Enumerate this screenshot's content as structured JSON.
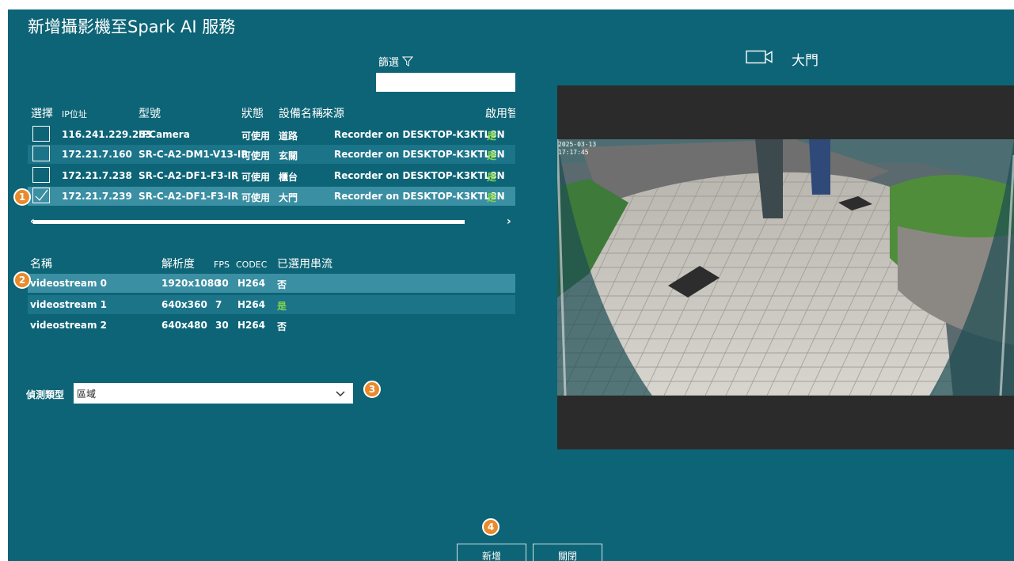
{
  "title": "新增攝影機至Spark AI 服務",
  "filter": {
    "label": "篩選",
    "value": ""
  },
  "camera_table": {
    "headers": {
      "select": "選擇",
      "ip": "IP位址",
      "model": "型號",
      "status": "狀態",
      "device_name": "設備名稱",
      "source": "來源",
      "enabled": "啟用智"
    },
    "rows": [
      {
        "ip": "116.241.229.253",
        "model": "IPCamera",
        "status": "可使用",
        "device_name": "道路",
        "source": "Recorder on DESKTOP-K3KTL8N",
        "enabled": "是",
        "checked": false
      },
      {
        "ip": "172.21.7.160",
        "model": "SR-C-A2-DM1-V13-IR",
        "status": "可使用",
        "device_name": "玄關",
        "source": "Recorder on DESKTOP-K3KTL8N",
        "enabled": "是",
        "checked": false
      },
      {
        "ip": "172.21.7.238",
        "model": "SR-C-A2-DF1-F3-IR",
        "status": "可使用",
        "device_name": "櫃台",
        "source": "Recorder on DESKTOP-K3KTL8N",
        "enabled": "是",
        "checked": false
      },
      {
        "ip": "172.21.7.239",
        "model": "SR-C-A2-DF1-F3-IR",
        "status": "可使用",
        "device_name": "大門",
        "source": "Recorder on DESKTOP-K3KTL8N",
        "enabled": "是",
        "checked": true
      }
    ],
    "scroll_left": "‹",
    "scroll_right": "›"
  },
  "stream_table": {
    "headers": {
      "name": "名稱",
      "resolution": "解析度",
      "fps": "FPS",
      "codec": "CODEC",
      "selected": "已選用串流"
    },
    "rows": [
      {
        "name": "videostream 0",
        "resolution": "1920x1080",
        "fps": "30",
        "codec": "H264",
        "selected": "否"
      },
      {
        "name": "videostream 1",
        "resolution": "640x360",
        "fps": "7",
        "codec": "H264",
        "selected": "是"
      },
      {
        "name": "videostream 2",
        "resolution": "640x480",
        "fps": "30",
        "codec": "H264",
        "selected": "否"
      }
    ]
  },
  "detection": {
    "label": "偵測類型",
    "value": "區域"
  },
  "buttons": {
    "add": "新增",
    "close": "關閉"
  },
  "badges": [
    "1",
    "2",
    "3",
    "4"
  ],
  "preview": {
    "camera_name": "大門",
    "timestamp": "2025-03-13 17:17:45"
  },
  "colors": {
    "background": "#0d6476",
    "selected_row": "#3b8fa3",
    "alt_row": "#1c7489",
    "badge": "#e98a2b",
    "yes_green": "#7fd34e"
  }
}
